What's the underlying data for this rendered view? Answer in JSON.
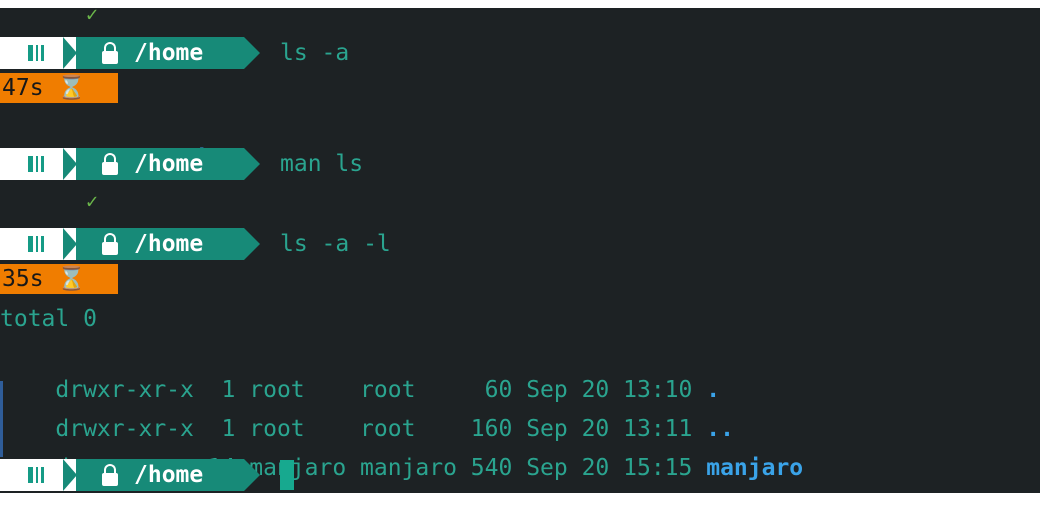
{
  "terminal": {
    "prompts": [
      {
        "dir": "/home",
        "command": "ls -a"
      },
      {
        "dir": "/home",
        "command": "man ls"
      },
      {
        "dir": "/home",
        "command": "ls -a -l"
      },
      {
        "dir": "/home",
        "command": ""
      }
    ],
    "check_symbol": "✓",
    "timers": [
      "47s ⌛",
      "35s ⌛"
    ],
    "ls_a_output": {
      "dots": ".  ..  ",
      "dir_name": "manjaro"
    },
    "ls_l_output": {
      "total": "total 0",
      "rows": [
        {
          "text": "drwxr-xr-x  1 root    root     60 Sep 20 13:10 ",
          "name": "."
        },
        {
          "text": "drwxr-xr-x  1 root    root    160 Sep 20 13:11 ",
          "name": ".."
        },
        {
          "text": "drwx------ 14 manjaro manjaro 540 Sep 20 15:15 ",
          "name": "manjaro"
        }
      ]
    },
    "colors": {
      "background": "#1d2224",
      "prompt_segment": "#178a78",
      "timer": "#f07d00",
      "text": "#2aa48f",
      "directory": "#3aa3e8"
    },
    "icons": [
      "manjaro-logo-icon",
      "lock-icon",
      "hourglass-icon",
      "checkmark-icon"
    ]
  }
}
